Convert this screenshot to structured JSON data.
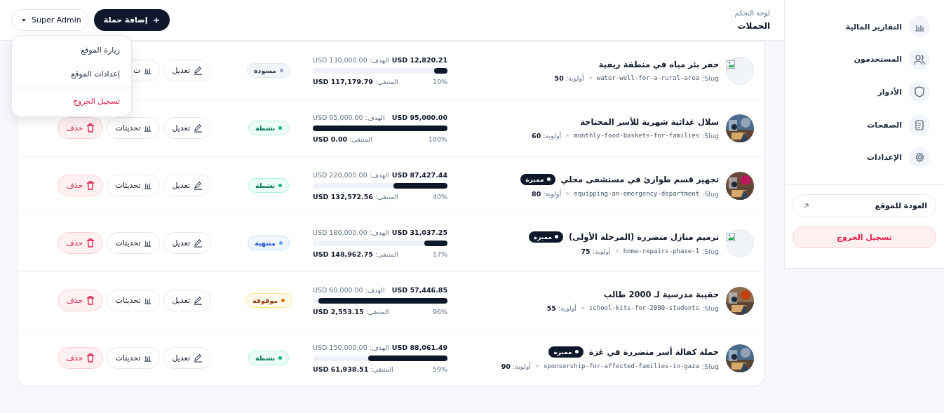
{
  "header": {
    "breadcrumb": "لوحة التحكم",
    "title": "الحملات",
    "add_button": "إضافة حملة",
    "user_button": "Super Admin"
  },
  "user_menu": [
    {
      "label": "زيارة الموقع",
      "kind": "link"
    },
    {
      "label": "إعدادات الموقع",
      "kind": "link"
    },
    {
      "label": "تسجيل الخروج",
      "kind": "danger"
    }
  ],
  "campaigns": [
    {
      "title": "حفر بئر مياه في منطقة ريفية",
      "slug_label": "Slug:",
      "slug": "water-well-for-a-rural-area",
      "priority": "أولوية: **50**",
      "thumb": {
        "kind": "broken"
      },
      "raised": "USD 12,820.21",
      "goal": "الهدف: USD 130,000.00",
      "level": 0.1,
      "percent": "10%",
      "remaining": "المتبقي: **USD 117,179.79**",
      "status": {
        "label": "مسودة",
        "kind": "draft"
      },
      "actions": [
        {
          "kind": "edit",
          "label": "تعديل"
        },
        {
          "kind": "updates",
          "label": "ت"
        }
      ]
    },
    {
      "title": "سلال غذائية شهرية للأسر المحتاجة",
      "slug_label": "Slug:",
      "slug": "monthly-food-baskets-for-families",
      "priority": "أولوية: **60**",
      "raised": "USD 95,000.00",
      "goal": "الهدف: USD 95,000.00",
      "level": 1,
      "percent": "100%",
      "remaining": "المتبقي: **USD 0.00**",
      "status": {
        "label": "نشطة",
        "kind": "active"
      },
      "actions": [
        {
          "kind": "edit",
          "label": "تعديل"
        },
        {
          "kind": "updates",
          "label": "تحديثات"
        },
        {
          "kind": "delete",
          "label": "حذف"
        }
      ]
    },
    {
      "title": "تجهيز قسم طوارئ في مستشفى محلي",
      "badge": "مميزة",
      "slug_label": "Slug:",
      "slug": "equipping-an-emergency-department",
      "priority": "أولوية: **80**",
      "raised": "USD 87,427.44",
      "goal": "الهدف: USD 220,000.00",
      "level": 0.4,
      "percent": "40%",
      "remaining": "المتبقي: **USD 132,572.56**",
      "status": {
        "label": "نشطة",
        "kind": "active"
      },
      "actions": [
        {
          "kind": "edit",
          "label": "تعديل"
        },
        {
          "kind": "updates",
          "label": "تحديثات"
        },
        {
          "kind": "delete",
          "label": "حذف"
        }
      ]
    },
    {
      "title": "ترميم منازل متضررة (المرحلة الأولى)",
      "badge": "مميزة",
      "slug_label": "Slug:",
      "slug": "home-repairs-phase-1",
      "priority": "أولوية: **75**",
      "thumb": {
        "kind": "broken"
      },
      "raised": "USD 31,037.25",
      "goal": "الهدف: USD 180,000.00",
      "level": 0.17,
      "percent": "17%",
      "remaining": "المتبقي: **USD 148,962.75**",
      "status": {
        "label": "منتهية",
        "kind": "ended"
      },
      "actions": [
        {
          "kind": "edit",
          "label": "تعديل"
        },
        {
          "kind": "updates",
          "label": "تحديثات"
        },
        {
          "kind": "delete",
          "label": "حذف"
        }
      ]
    },
    {
      "title": "حقيبة مدرسية لـ 2000 طالب",
      "slug_label": "Slug:",
      "slug": "school-kits-for-2000-students",
      "priority": "أولوية: **55**",
      "raised": "USD 57,446.85",
      "goal": "الهدف: USD 60,000.00",
      "level": 0.96,
      "percent": "96%",
      "remaining": "المتبقي: **USD 2,553.15**",
      "status": {
        "label": "موقوفة",
        "kind": "paused"
      },
      "actions": [
        {
          "kind": "edit",
          "label": "تعديل"
        },
        {
          "kind": "updates",
          "label": "تحديثات"
        },
        {
          "kind": "delete",
          "label": "حذف"
        }
      ]
    },
    {
      "title": "حملة كفالة أسر متضررة في غزة",
      "badge": "مميزة",
      "slug_label": "Slug:",
      "slug": "sponsorship-for-affected-families-in-gaza",
      "priority": "أولوية: **90**",
      "raised": "USD 88,061.49",
      "goal": "الهدف: USD 150,000.00",
      "level": 0.59,
      "percent": "59%",
      "remaining": "المتبقي: **USD 61,938.51**",
      "status": {
        "label": "نشطة",
        "kind": "active"
      },
      "actions": [
        {
          "kind": "edit",
          "label": "تعديل"
        },
        {
          "kind": "updates",
          "label": "تحديثات"
        },
        {
          "kind": "delete",
          "label": "حذف"
        }
      ]
    }
  ],
  "sidebar": {
    "items": [
      {
        "label": "التقارير المالية",
        "kind": "chart",
        "selected": false
      },
      {
        "label": "المستخدمون",
        "kind": "users",
        "selected": false
      },
      {
        "label": "الأدوار",
        "kind": "shield",
        "selected": false
      },
      {
        "label": "الصفحات",
        "kind": "file",
        "selected": false
      },
      {
        "label": "الإعدادات",
        "kind": "gear",
        "selected": false
      }
    ],
    "back_button": "العودة للموقع",
    "logout_button": "تسجيل الخروج"
  }
}
